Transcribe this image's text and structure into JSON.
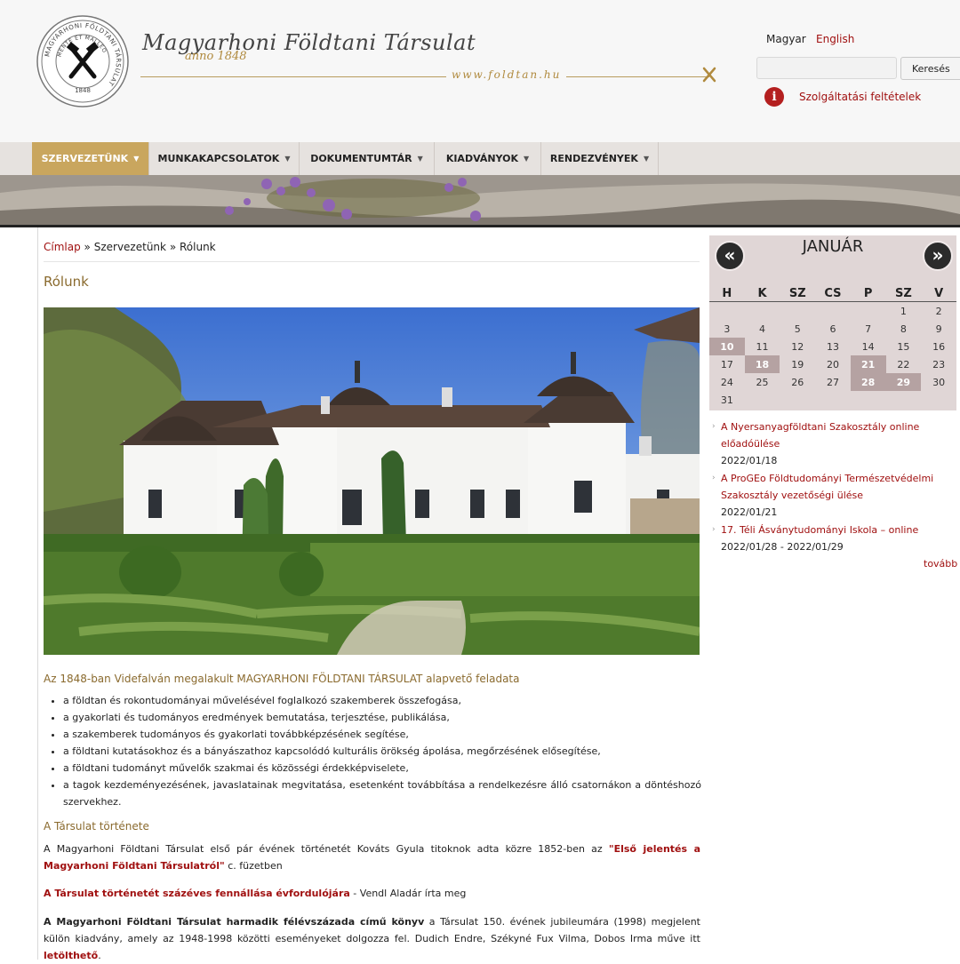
{
  "header": {
    "title": "Magyarhoni Földtani Társulat",
    "subtitle": "anno 1848",
    "url": "www.foldtan.hu",
    "seal": {
      "outer_text": "MAGYARHONI FÖLDTANI TÁRSULAT",
      "motto": "MENTE ET MALLEO",
      "year": "1848"
    }
  },
  "languages": [
    "Magyar",
    "English"
  ],
  "search": {
    "value": "",
    "button_label": "Keresés"
  },
  "terms_link": "Szolgáltatási feltételek",
  "nav": [
    {
      "label": "SZERVEZETÜNK",
      "active": true
    },
    {
      "label": "MUNKAKAPCSOLATOK",
      "active": false
    },
    {
      "label": "DOKUMENTUMTÁR",
      "active": false
    },
    {
      "label": "KIADVÁNYOK",
      "active": false
    },
    {
      "label": "RENDEZVÉNYEK",
      "active": false
    }
  ],
  "breadcrumb": {
    "home": "Címlap",
    "sep": "»",
    "section": "Szervezetünk",
    "current": "Rólunk"
  },
  "page_title": "Rólunk",
  "intro": "Az 1848-ban Videfalván megalakult MAGYARHONI FÖLDTANI TÁRSULAT alapvető feladata",
  "duties": [
    "a földtan és rokontudományai művelésével foglalkozó szakemberek összefogása,",
    "a gyakorlati és tudományos eredmények bemutatása, terjesztése, publikálása,",
    "a szakemberek tudományos és gyakorlati továbbképzésének segítése,",
    "a földtani kutatásokhoz  és a bányászathoz kapcsolódó kulturális örökség ápolása, megőrzésének elősegítése,",
    "a földtani tudományt művelők szakmai és közösségi érdekképviselete,",
    "a tagok kezdeményezésének, javaslatainak megvitatása, esetenként továbbítása a rendelkezésre álló csatornákon a döntéshozó szervekhez."
  ],
  "history": {
    "title": "A Társulat története",
    "p1_text": "A Magyarhoni Földtani Társulat első pár évének történetét Kováts Gyula titoknok adta közre 1852-ben az ",
    "p1_link": "\"Első jelentés a Magyarhoni Földtani Társulatról\"",
    "p1_suffix": " c. füzetben",
    "p2_link": "A Társulat történetét százéves fennállása évfordulójára",
    "p2_suffix": " - Vendl Aladár írta meg",
    "p3_bold": "A Magyarhoni Földtani Társulat harmadik félévszázada című könyv",
    "p3_text": " a Társulat 150. évének jubileumára (1998) megjelent külön kiadvány, amely az 1948-1998 közötti eseményeket dolgozza fel. Dudich Endre, Székyné Fux Vilma, Dobos Irma műve itt ",
    "p3_link": "letölthető",
    "p3_end": "."
  },
  "calendar": {
    "month": "JANUÁR",
    "weekdays": [
      "H",
      "K",
      "SZ",
      "CS",
      "P",
      "SZ",
      "V"
    ],
    "weeks": [
      [
        "",
        "",
        "",
        "",
        "",
        "1",
        "2"
      ],
      [
        "3",
        "4",
        "5",
        "6",
        "7",
        "8",
        "9"
      ],
      [
        "10",
        "11",
        "12",
        "13",
        "14",
        "15",
        "16"
      ],
      [
        "17",
        "18",
        "19",
        "20",
        "21",
        "22",
        "23"
      ],
      [
        "24",
        "25",
        "26",
        "27",
        "28",
        "29",
        "30"
      ],
      [
        "31",
        "",
        "",
        "",
        "",
        "",
        ""
      ]
    ],
    "highlighted": [
      "10",
      "18",
      "21",
      "28",
      "29"
    ],
    "prev_icon": "double-chevron-left-icon",
    "next_icon": "double-chevron-right-icon"
  },
  "events": [
    {
      "title": "A Nyersanyagföldtani Szakosztály online előadóülése",
      "date": "2022/01/18"
    },
    {
      "title": "A ProGEo Földtudományi Természetvédelmi Szakosztály vezetőségi ülése",
      "date": "2022/01/21"
    },
    {
      "title": "17. Téli Ásványtudományi Iskola – online",
      "date": "2022/01/28 - 2022/01/29"
    }
  ],
  "more_link": "tovább",
  "colors": {
    "accent_gold": "#c9a65e",
    "link_red": "#a01010",
    "title_brown": "#8a6a2e",
    "calendar_bg": "#e0d6d6"
  }
}
